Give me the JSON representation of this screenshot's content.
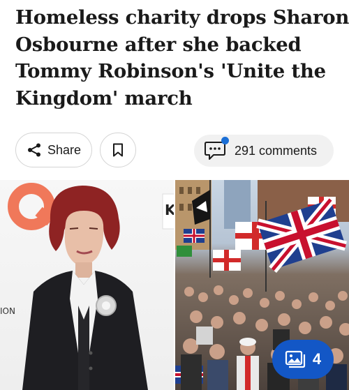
{
  "article": {
    "headline_lines": [
      "Homeless charity drops Sharon",
      "Osbourne after she backed",
      "Tommy Robinson's 'Unite the",
      "Kingdom' march"
    ]
  },
  "actions": {
    "share_label": "Share",
    "comments_label": "291 comments"
  },
  "gallery": {
    "count": "4",
    "left_photo_fragment": "ION",
    "logo_letter": "K"
  },
  "icons": {
    "share": "share-icon",
    "bookmark": "bookmark-icon",
    "comments": "comment-bubble-icon",
    "gallery": "gallery-icon"
  },
  "colors": {
    "accent_blue": "#1357c6",
    "notification_dot": "#1b6fd6"
  }
}
